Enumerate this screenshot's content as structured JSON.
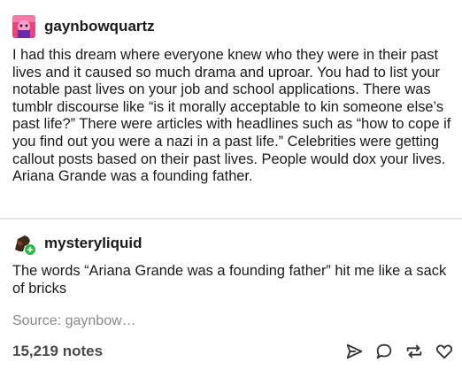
{
  "post": {
    "entries": [
      {
        "username": "gaynbowquartz",
        "text": "I had this dream where everyone knew who they were in their past lives and it caused so much drama and uproar. You had to list your notable past lives on your job and school applications. There was tumblr discourse like “is it morally acceptable to kin someone else’s past life?” There were articles with headlines such as “how to cope if you find out you were a nazi in a past life.” Celebrities were getting callout posts based on their past lives. People would dox your lives. Ariana Grande was a founding father."
      },
      {
        "username": "mysteryliquid",
        "text": "The words “Ariana Grande was a founding father” hit me like a sack of bricks"
      }
    ],
    "source": {
      "label": "Source:",
      "link": "gaynbow…"
    },
    "notes": "15,219 notes",
    "icons": {
      "share": "paper-plane-icon",
      "reply": "speech-bubble-icon",
      "reblog": "reblog-icon",
      "like": "heart-icon"
    }
  }
}
